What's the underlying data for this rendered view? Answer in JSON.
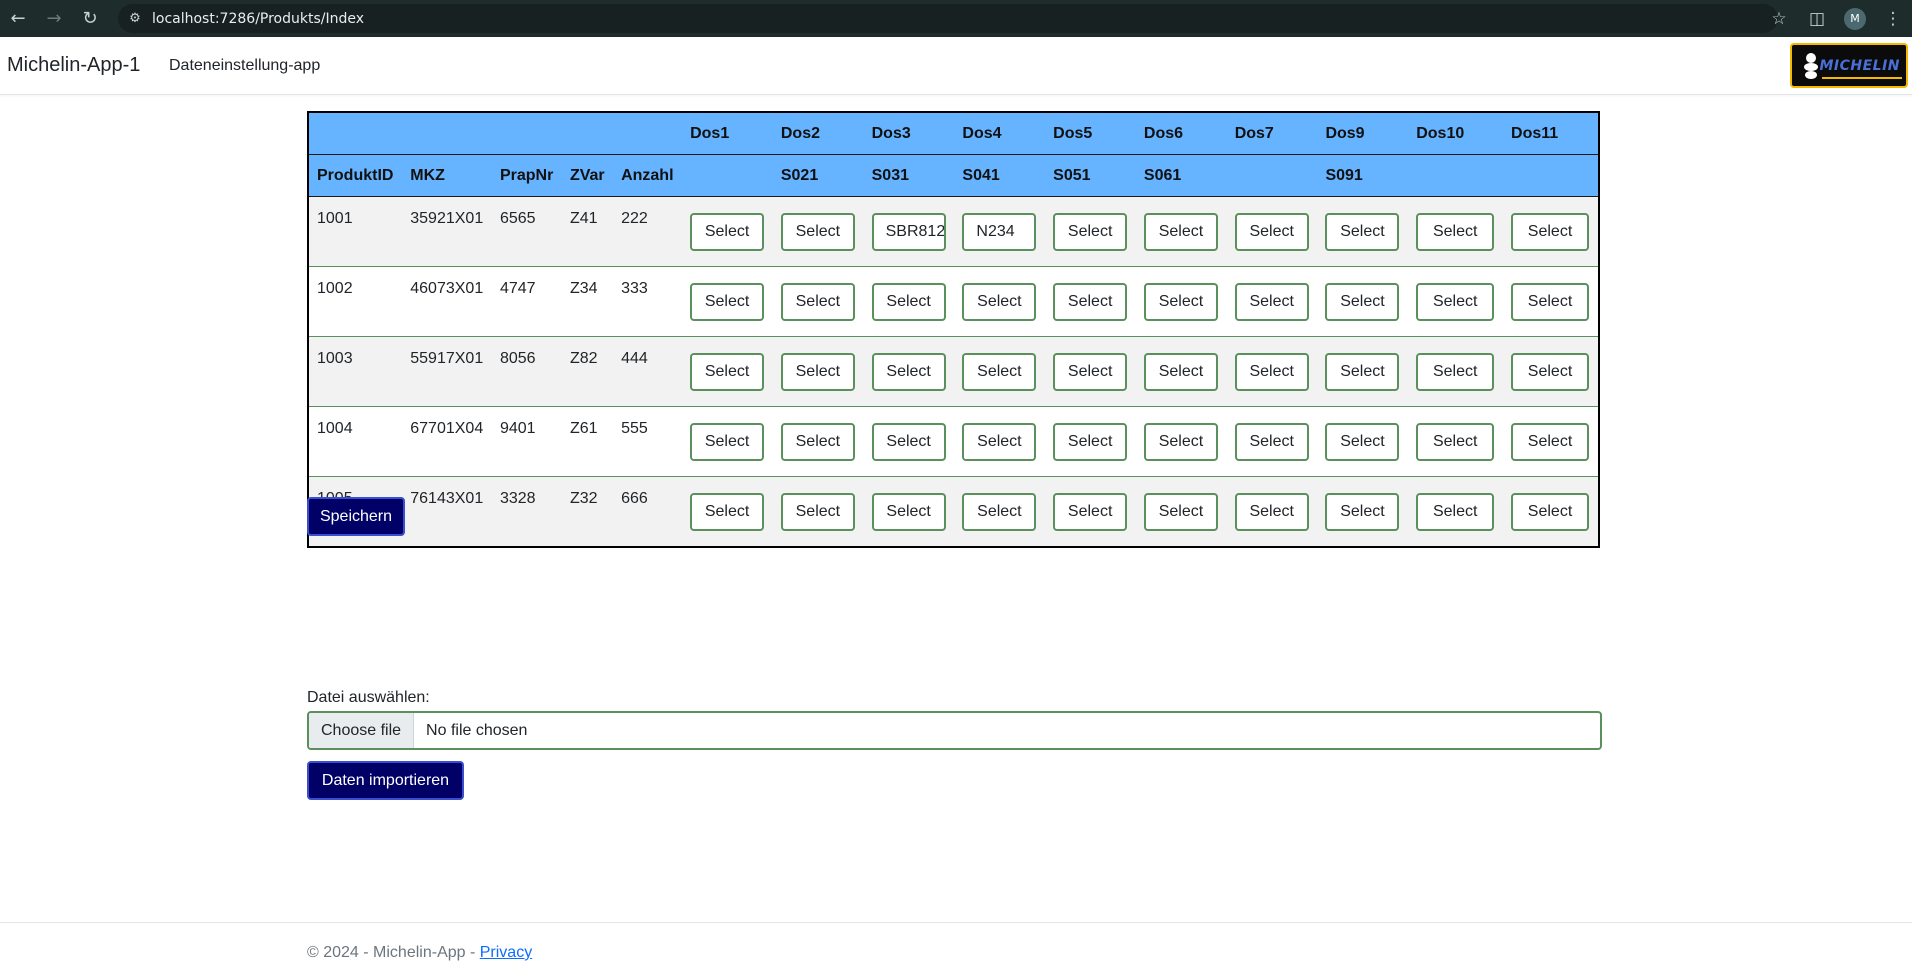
{
  "browser": {
    "url": "localhost:7286/Produkts/Index",
    "profile_initial": "M"
  },
  "navbar": {
    "brand": "Michelin-App-1",
    "link": "Dateneinstellung-app",
    "logo_text": "MICHELIN"
  },
  "table": {
    "header_row1": [
      "",
      "",
      "",
      "",
      "",
      "Dos1",
      "Dos2",
      "Dos3",
      "Dos4",
      "Dos5",
      "Dos6",
      "Dos7",
      "Dos9",
      "Dos10",
      "Dos11"
    ],
    "header_row2": [
      "ProduktID",
      "MKZ",
      "PrapNr",
      "ZVar",
      "Anzahl",
      "",
      "S021",
      "S031",
      "S041",
      "S051",
      "S061",
      "",
      "S091",
      "",
      ""
    ],
    "rows": [
      {
        "produktid": "1001",
        "mkz": "35921X01",
        "prapnr": "6565",
        "zvar": "Z41",
        "anzahl": "222",
        "selects": [
          "Select",
          "Select",
          "SBR812",
          "N234",
          "Select",
          "Select",
          "Select",
          "Select",
          "Select",
          "Select"
        ]
      },
      {
        "produktid": "1002",
        "mkz": "46073X01",
        "prapnr": "4747",
        "zvar": "Z34",
        "anzahl": "333",
        "selects": [
          "Select",
          "Select",
          "Select",
          "Select",
          "Select",
          "Select",
          "Select",
          "Select",
          "Select",
          "Select"
        ]
      },
      {
        "produktid": "1003",
        "mkz": "55917X01",
        "prapnr": "8056",
        "zvar": "Z82",
        "anzahl": "444",
        "selects": [
          "Select",
          "Select",
          "Select",
          "Select",
          "Select",
          "Select",
          "Select",
          "Select",
          "Select",
          "Select"
        ]
      },
      {
        "produktid": "1004",
        "mkz": "67701X04",
        "prapnr": "9401",
        "zvar": "Z61",
        "anzahl": "555",
        "selects": [
          "Select",
          "Select",
          "Select",
          "Select",
          "Select",
          "Select",
          "Select",
          "Select",
          "Select",
          "Select"
        ]
      },
      {
        "produktid": "1005",
        "mkz": "76143X01",
        "prapnr": "3328",
        "zvar": "Z32",
        "anzahl": "666",
        "selects": [
          "Select",
          "Select",
          "Select",
          "Select",
          "Select",
          "Select",
          "Select",
          "Select",
          "Select",
          "Select"
        ]
      }
    ]
  },
  "buttons": {
    "save": "Speichern",
    "import": "Daten importieren"
  },
  "file_upload": {
    "label": "Datei auswählen:",
    "choose_button": "Choose file",
    "status": "No file chosen"
  },
  "footer": {
    "text": "© 2024 - Michelin-App - ",
    "privacy_link": "Privacy"
  },
  "colors": {
    "table_header": "#66b3ff",
    "primary_button": "#000066",
    "select_border": "#5b8f5b",
    "logo_border": "#f5b800"
  }
}
